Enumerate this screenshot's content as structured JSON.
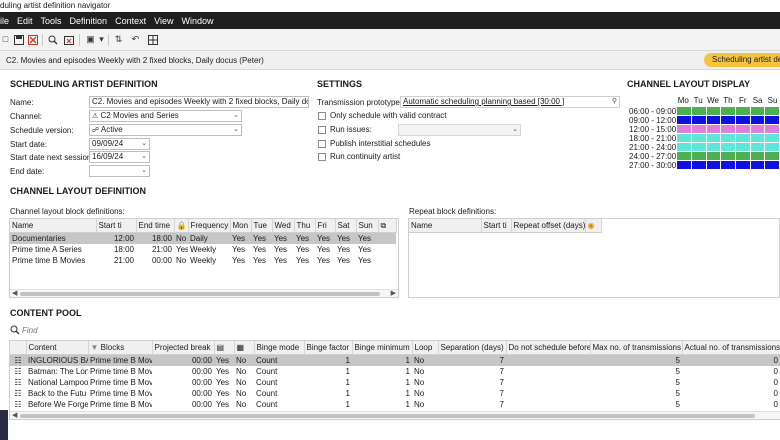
{
  "window": {
    "title": "duling artist definition navigator"
  },
  "menu": [
    "ile",
    "Edit",
    "Tools",
    "Definition",
    "Context",
    "View",
    "Window"
  ],
  "infobar": {
    "text": "C2. Movies and episodes Weekly with 2 fixed blocks, Daily docus (Peter)",
    "pill": "Scheduling artist def"
  },
  "sad": {
    "heading": "SCHEDULING ARTIST DEFINITION",
    "name_label": "Name:",
    "name_value": "C2. Movies and episodes Weekly with 2 fixed blocks, Daily docus",
    "channel_label": "Channel:",
    "channel_value": "C2 Movies and Series",
    "version_label": "Schedule version:",
    "version_value": "Active",
    "start_label": "Start date:",
    "start_value": "09/09/24",
    "next_label": "Start date next session:",
    "next_value": "16/09/24",
    "end_label": "End date:",
    "end_value": ""
  },
  "settings": {
    "heading": "SETTINGS",
    "tp_label": "Transmission prototype:",
    "tp_value": "Automatic scheduling planning based [30:00 ]",
    "opt1": "Only schedule with valid contract",
    "opt2": "Run issues:",
    "opt3": "Publish interstitial schedules",
    "opt4": "Run continuity artist"
  },
  "channel_layout_display": {
    "heading": "CHANNEL LAYOUT DISPLAY",
    "days": [
      "Mo",
      "Tu",
      "We",
      "Th",
      "Fr",
      "Sa",
      "Su"
    ],
    "colors": {
      "green": "#4caf50",
      "blue": "#1010e0",
      "pink": "#e07ee0",
      "aqua": "#5ee6d8",
      "grey": "#ffffff"
    },
    "rows": [
      {
        "time": "06:00 - 09:00",
        "cells": [
          "green",
          "green",
          "green",
          "green",
          "green",
          "green",
          "green"
        ]
      },
      {
        "time": "09:00 - 12:00",
        "cells": [
          "blue",
          "blue",
          "blue",
          "blue",
          "blue",
          "blue",
          "blue"
        ]
      },
      {
        "time": "12:00 - 15:00",
        "cells": [
          "pink",
          "pink",
          "pink",
          "pink",
          "pink",
          "pink",
          "pink"
        ]
      },
      {
        "time": "18:00 - 21:00",
        "cells": [
          "aqua",
          "aqua",
          "aqua",
          "aqua",
          "aqua",
          "aqua",
          "aqua"
        ]
      },
      {
        "time": "21:00 - 24:00",
        "cells": [
          "aqua",
          "aqua",
          "aqua",
          "aqua",
          "aqua",
          "aqua",
          "aqua"
        ]
      },
      {
        "time": "24:00 - 27:00",
        "cells": [
          "green",
          "green",
          "green",
          "green",
          "green",
          "green",
          "green"
        ]
      },
      {
        "time": "27:00 - 30:00",
        "cells": [
          "blue",
          "blue",
          "blue",
          "blue",
          "blue",
          "blue",
          "blue"
        ]
      }
    ]
  },
  "cld": {
    "heading": "CHANNEL LAYOUT DEFINITION",
    "sub": "Channel layout block definitions:",
    "columns": [
      "Name",
      "Start ti",
      "End time",
      "",
      "Frequency",
      "Mon",
      "Tue",
      "Wed",
      "Thu",
      "Fri",
      "Sat",
      "Sun"
    ],
    "rows": [
      [
        "Documentaries",
        "12:00",
        "18:00",
        "No",
        "Daily",
        "Yes",
        "Yes",
        "Yes",
        "Yes",
        "Yes",
        "Yes",
        "Yes"
      ],
      [
        "Prime time A Series",
        "18:00",
        "21:00",
        "Yes",
        "Weekly",
        "Yes",
        "Yes",
        "Yes",
        "Yes",
        "Yes",
        "Yes",
        "Yes"
      ],
      [
        "Prime time B Movies",
        "21:00",
        "00:00",
        "No",
        "Weekly",
        "Yes",
        "Yes",
        "Yes",
        "Yes",
        "Yes",
        "Yes",
        "Yes"
      ]
    ],
    "repeat_sub": "Repeat block definitions:",
    "repeat_columns": [
      "Name",
      "Start ti",
      "Repeat offset (days)"
    ]
  },
  "pool": {
    "heading": "CONTENT POOL",
    "find_placeholder": "Find",
    "columns": [
      "Content",
      "Blocks",
      "Projected break",
      "",
      "",
      "Binge mode",
      "Binge factor",
      "Binge minimum",
      "Loop",
      "Separation (days)",
      "Do not schedule before",
      "Max no. of transmissions",
      "Actual no. of transmissions",
      "C"
    ],
    "rows": [
      [
        "INGLORIOUS BA",
        "Prime time B Mov",
        "00:00",
        "Yes",
        "No",
        "Count",
        "1",
        "1",
        "No",
        "7",
        "",
        "5",
        "0"
      ],
      [
        "Batman: The Long",
        "Prime time B Mov",
        "00:00",
        "Yes",
        "No",
        "Count",
        "1",
        "1",
        "No",
        "7",
        "",
        "5",
        "0"
      ],
      [
        "National Lampoo",
        "Prime time B Mov",
        "00:00",
        "Yes",
        "No",
        "Count",
        "1",
        "1",
        "No",
        "7",
        "",
        "5",
        "0"
      ],
      [
        "Back to the Futu",
        "Prime time B Mov",
        "00:00",
        "Yes",
        "No",
        "Count",
        "1",
        "1",
        "No",
        "7",
        "",
        "5",
        "0"
      ],
      [
        "Before We Forget",
        "Prime time B Mov",
        "00:00",
        "Yes",
        "No",
        "Count",
        "1",
        "1",
        "No",
        "7",
        "",
        "5",
        "0"
      ]
    ]
  }
}
